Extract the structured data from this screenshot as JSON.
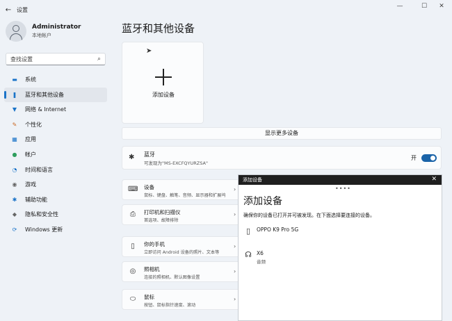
{
  "window": {
    "title": "设置",
    "back_glyph": "←",
    "minimize_glyph": "—",
    "maximize_glyph": "☐",
    "close_glyph": "✕"
  },
  "profile": {
    "name": "Administrator",
    "account_type": "本地帐户"
  },
  "search": {
    "value": "查找设置",
    "icon": "search-icon"
  },
  "sidebar": {
    "items": [
      {
        "label": "系统",
        "icon": "monitor-icon",
        "glyph": "▬"
      },
      {
        "label": "蓝牙和其他设备",
        "icon": "bluetooth-devices-icon",
        "glyph": "❚"
      },
      {
        "label": "网络 & Internet",
        "icon": "wifi-icon",
        "glyph": "▼"
      },
      {
        "label": "个性化",
        "icon": "brush-icon",
        "glyph": "✎"
      },
      {
        "label": "应用",
        "icon": "apps-icon",
        "glyph": "▦"
      },
      {
        "label": "帐户",
        "icon": "person-icon",
        "glyph": "●"
      },
      {
        "label": "时间和语言",
        "icon": "globe-clock-icon",
        "glyph": "◔"
      },
      {
        "label": "游戏",
        "icon": "gamepad-icon",
        "glyph": "◉"
      },
      {
        "label": "辅助功能",
        "icon": "accessibility-icon",
        "glyph": "✱"
      },
      {
        "label": "隐私和安全性",
        "icon": "shield-icon",
        "glyph": "◆"
      },
      {
        "label": "Windows 更新",
        "icon": "update-icon",
        "glyph": "⟳"
      }
    ],
    "active_index": 1,
    "accent_color": "#1a73c8"
  },
  "main": {
    "title": "蓝牙和其他设备",
    "add_device_label": "添加设备",
    "show_more_label": "显示更多设备",
    "bluetooth": {
      "title": "蓝牙",
      "subtitle": "可发现为\"MS-EXCFQYURZSA\"",
      "state_label": "开",
      "icon_glyph": "✱",
      "toggle_on": true
    },
    "rows": [
      {
        "title": "设备",
        "subtitle": "鼠标、键盘、触笔、音频、显示器和扩展坞",
        "icon": "keyboard-icon",
        "glyph": "⌨"
      },
      {
        "title": "打印机和扫描仪",
        "subtitle": "首选项、故障排除",
        "icon": "printer-icon",
        "glyph": "⎙"
      },
      {
        "title": "你的手机",
        "subtitle": "立即访问 Android 设备的照片、文本等",
        "icon": "phone-icon",
        "glyph": "▯"
      },
      {
        "title": "照相机",
        "subtitle": "连接的照相机、默认图像设置",
        "icon": "camera-icon",
        "glyph": "◎"
      },
      {
        "title": "鼠标",
        "subtitle": "按钮、鼠标指针速度、滚动",
        "icon": "mouse-icon",
        "glyph": "⬭"
      }
    ],
    "chevron_glyph": "›"
  },
  "dialog": {
    "header": "添加设备",
    "title": "添加设备",
    "description": "确保你的设备已打开并可被发现。在下面选择要连接的设备。",
    "close_glyph": "✕",
    "grip_glyph": "••••",
    "devices": [
      {
        "name": "OPPO K9 Pro 5G",
        "sub": "",
        "icon": "phone-icon",
        "glyph": "▯"
      },
      {
        "name": "X6",
        "sub": "音频",
        "icon": "headphones-icon",
        "glyph": "☊"
      }
    ]
  }
}
